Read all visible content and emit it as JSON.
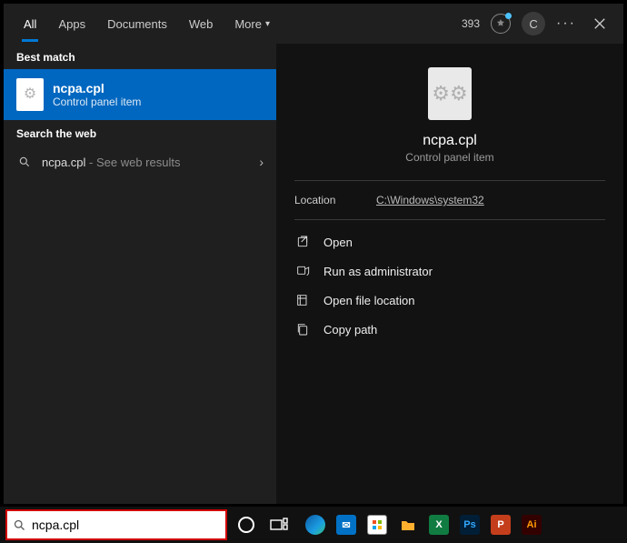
{
  "header": {
    "tabs": [
      "All",
      "Apps",
      "Documents",
      "Web",
      "More"
    ],
    "active_tab_index": 0,
    "points": "393",
    "avatar_letter": "C",
    "more_dots": "···"
  },
  "left": {
    "best_match_label": "Best match",
    "best_match": {
      "title": "ncpa.cpl",
      "subtitle": "Control panel item"
    },
    "search_web_label": "Search the web",
    "web_result": {
      "term": "ncpa.cpl",
      "suffix": " - See web results"
    }
  },
  "right": {
    "title": "ncpa.cpl",
    "subtitle": "Control panel item",
    "location_label": "Location",
    "location_path": "C:\\Windows\\system32",
    "actions": {
      "open": "Open",
      "runadmin": "Run as administrator",
      "openloc": "Open file location",
      "copypath": "Copy path"
    }
  },
  "taskbar": {
    "search_value": "ncpa.cpl",
    "apps": [
      {
        "name": "edge",
        "bg": "linear-gradient(135deg,#0c59a4,#1b9de2 60%,#33c481)",
        "label": ""
      },
      {
        "name": "mail",
        "bg": "#0071c5",
        "label": "✉"
      },
      {
        "name": "store",
        "bg": "#ffffff",
        "label": "",
        "store": true
      },
      {
        "name": "explorer",
        "bg": "#ffcc4d",
        "label": "",
        "folder": true
      },
      {
        "name": "excel",
        "bg": "#107c41",
        "label": "X"
      },
      {
        "name": "photoshop",
        "bg": "#001e36",
        "label": "Ps"
      },
      {
        "name": "powerpoint",
        "bg": "#c43e1c",
        "label": "P"
      },
      {
        "name": "illustrator",
        "bg": "#330000",
        "label": "Ai"
      }
    ]
  }
}
